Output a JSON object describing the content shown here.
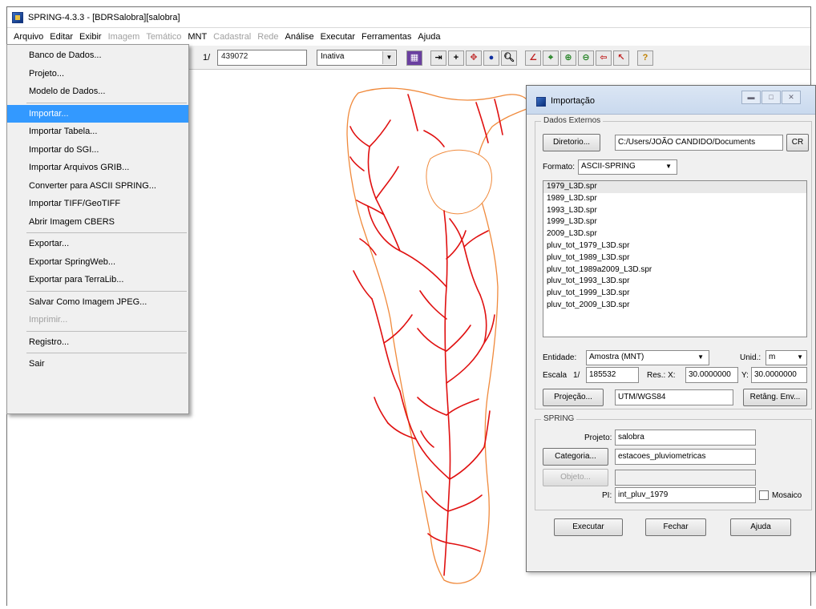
{
  "window": {
    "title": "SPRING-4.3.3 - [BDRSalobra][salobra]"
  },
  "menubar": {
    "items": [
      {
        "label": "Arquivo",
        "enabled": true
      },
      {
        "label": "Editar",
        "enabled": true
      },
      {
        "label": "Exibir",
        "enabled": true
      },
      {
        "label": "Imagem",
        "enabled": false
      },
      {
        "label": "Temático",
        "enabled": false
      },
      {
        "label": "MNT",
        "enabled": true
      },
      {
        "label": "Cadastral",
        "enabled": false
      },
      {
        "label": "Rede",
        "enabled": false
      },
      {
        "label": "Análise",
        "enabled": true
      },
      {
        "label": "Executar",
        "enabled": true
      },
      {
        "label": "Ferramentas",
        "enabled": true
      },
      {
        "label": "Ajuda",
        "enabled": true
      }
    ]
  },
  "toolbar": {
    "scale_prefix": "1/",
    "scale_value": "439072",
    "state_value": "Inativa",
    "buttons": [
      "grid-icon",
      "arrow-right-bar-icon",
      "crosshair-icon",
      "pan-icon",
      "info-icon",
      "zoom-icon",
      "draw-line-icon",
      "zoom-area-icon",
      "zoom-in-icon",
      "zoom-out-icon",
      "back-icon",
      "cursor-icon",
      "help-icon"
    ]
  },
  "arquivo_menu": {
    "items": [
      {
        "label": "Banco de Dados...",
        "enabled": true
      },
      {
        "label": "Projeto...",
        "enabled": true
      },
      {
        "label": "Modelo de Dados...",
        "enabled": true
      },
      {
        "sep": true
      },
      {
        "label": "Importar...",
        "enabled": true,
        "highlight": true
      },
      {
        "label": "Importar Tabela...",
        "enabled": true
      },
      {
        "label": "Importar do SGI...",
        "enabled": true
      },
      {
        "label": "Importar Arquivos GRIB...",
        "enabled": true
      },
      {
        "label": "Converter para ASCII SPRING...",
        "enabled": true
      },
      {
        "label": "Importar TIFF/GeoTIFF",
        "enabled": true
      },
      {
        "label": "Abrir Imagem CBERS",
        "enabled": true
      },
      {
        "sep": true
      },
      {
        "label": "Exportar...",
        "enabled": true
      },
      {
        "label": "Exportar SpringWeb...",
        "enabled": true
      },
      {
        "label": "Exportar para TerraLib...",
        "enabled": true
      },
      {
        "sep": true
      },
      {
        "label": "Salvar Como Imagem JPEG...",
        "enabled": true
      },
      {
        "label": "Imprimir...",
        "enabled": false
      },
      {
        "sep": true
      },
      {
        "label": "Registro...",
        "enabled": true
      },
      {
        "sep": true
      },
      {
        "label": "Sair",
        "enabled": true
      }
    ]
  },
  "import_dialog": {
    "title": "Importação",
    "external_group_label": "Dados Externos",
    "directory_button": "Diretorio...",
    "directory_path": "C:/Users/JOÃO CANDIDO/Documents",
    "cr_button": "CR",
    "format_label": "Formato:",
    "format_value": "ASCII-SPRING",
    "files": [
      "1979_L3D.spr",
      "1989_L3D.spr",
      "1993_L3D.spr",
      "1999_L3D.spr",
      "2009_L3D.spr",
      "pluv_tot_1979_L3D.spr",
      "pluv_tot_1989_L3D.spr",
      "pluv_tot_1989a2009_L3D.spr",
      "pluv_tot_1993_L3D.spr",
      "pluv_tot_1999_L3D.spr",
      "pluv_tot_2009_L3D.spr"
    ],
    "entity_label": "Entidade:",
    "entity_value": "Amostra (MNT)",
    "unit_label": "Unid.:",
    "unit_value": "m",
    "scale_label": "Escala",
    "scale_prefix": "1/",
    "scale_value": "185532",
    "res_label": "Res.: X:",
    "res_x": "30.0000000",
    "res_y_label": "Y:",
    "res_y": "30.0000000",
    "projection_button": "Projeção...",
    "projection_value": "UTM/WGS84",
    "retang_button": "Retâng. Env...",
    "spring_group_label": "SPRING",
    "project_label": "Projeto:",
    "project_value": "salobra",
    "category_button": "Categoria...",
    "category_value": "estacoes_pluviometricas",
    "object_button": "Objeto...",
    "object_value": "",
    "pi_label": "PI:",
    "pi_value": "int_pluv_1979",
    "mosaic_label": "Mosaico",
    "execute_button": "Executar",
    "close_button": "Fechar",
    "help_button": "Ajuda"
  },
  "colors": {
    "drainage": "#e01010",
    "boundary": "#f08a3c",
    "highlight": "#3399ff"
  }
}
